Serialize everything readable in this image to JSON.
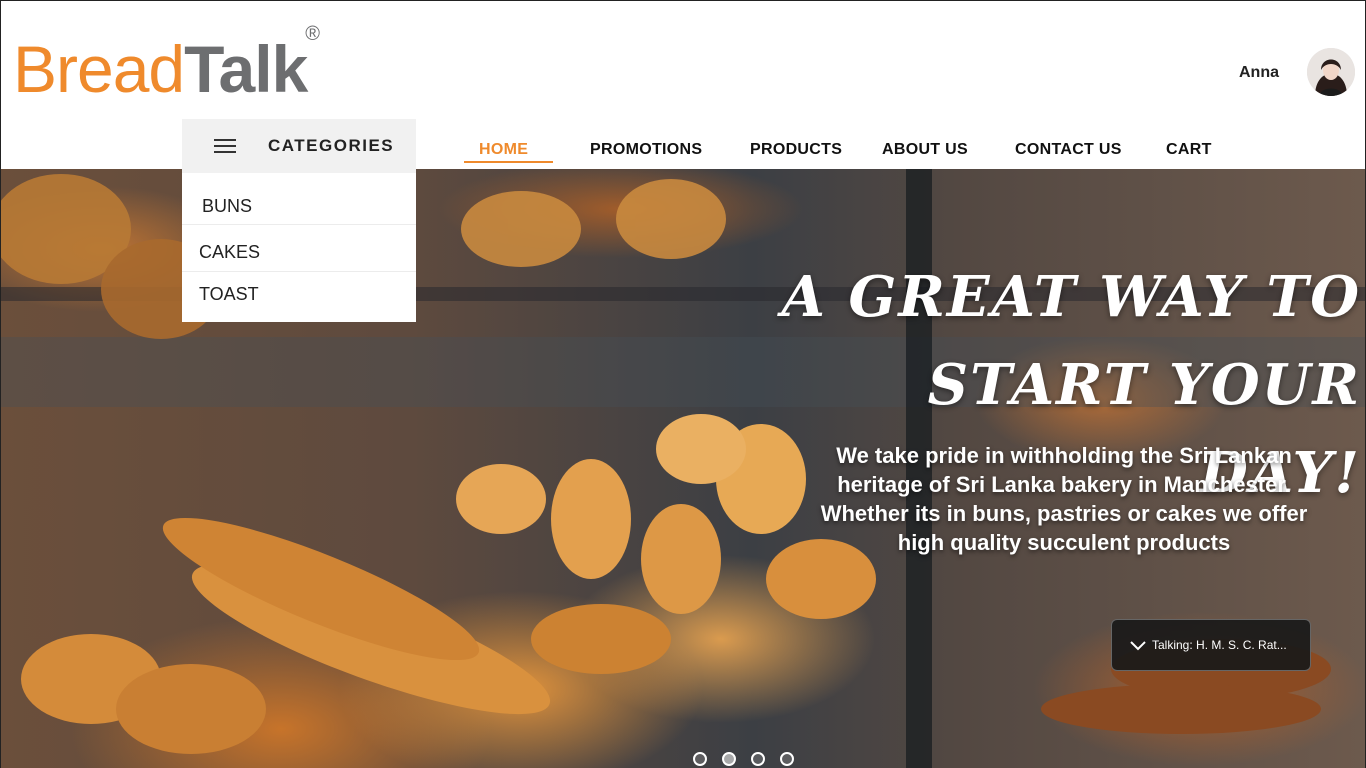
{
  "brand": {
    "name_part1": "Bread",
    "name_part2": "Talk",
    "registered": "®"
  },
  "user": {
    "name": "Anna"
  },
  "categories": {
    "title": "CATEGORIES",
    "items": [
      {
        "label": "BUNS"
      },
      {
        "label": "CAKES"
      },
      {
        "label": "TOAST"
      }
    ]
  },
  "nav": {
    "items": [
      {
        "label": "HOME",
        "active": true
      },
      {
        "label": "PROMOTIONS"
      },
      {
        "label": "PRODUCTS"
      },
      {
        "label": "ABOUT US"
      },
      {
        "label": "CONTACT US"
      },
      {
        "label": "CART"
      }
    ]
  },
  "hero": {
    "title_line1": "A GREAT WAY TO",
    "title_line2": "START YOUR DAY!",
    "description": "We take pride in withholding the Sri Lankan heritage of Sri Lanka bakery in Manchester. Whether its in buns, pastries or cakes we offer high quality succulent products",
    "slides": {
      "count": 4,
      "active_index": 1
    }
  },
  "talking": {
    "text": "Talking: H. M. S. C. Rat..."
  },
  "colors": {
    "accent": "#ef8a2c",
    "logo_gray": "#6d6e70"
  }
}
